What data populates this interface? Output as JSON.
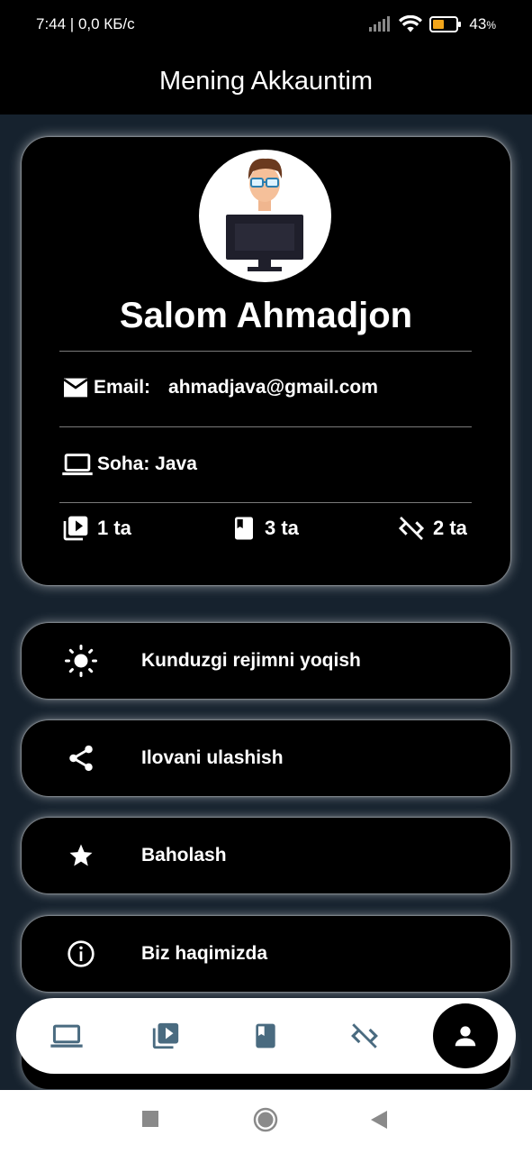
{
  "status_bar": {
    "time_speed": "7:44 | 0,0 КБ/с",
    "battery_percent": "43",
    "battery_unit": "%"
  },
  "app_bar": {
    "title": "Mening Akkauntim"
  },
  "profile": {
    "greeting": "Salom Ahmadjon",
    "email_label": "Email:",
    "email_value": "ahmadjava@gmail.com",
    "field_label": "Soha: Java",
    "stats": [
      {
        "icon": "video-library-icon",
        "value": "1 ta"
      },
      {
        "icon": "book-icon",
        "value": "3 ta"
      },
      {
        "icon": "code-off-icon",
        "value": "2 ta"
      }
    ]
  },
  "menu": [
    {
      "icon": "sun-icon",
      "label": "Kunduzgi rejimni yoqish"
    },
    {
      "icon": "share-icon",
      "label": "Ilovani ulashish"
    },
    {
      "icon": "star-icon",
      "label": "Baholash"
    },
    {
      "icon": "info-icon",
      "label": "Biz haqimizda"
    }
  ],
  "bottom_nav": {
    "items": [
      "laptop-icon",
      "video-library-icon",
      "book-icon",
      "code-off-icon",
      "person-icon"
    ],
    "active": "person-icon",
    "icon_color": "#4a6b80"
  },
  "colors": {
    "background": "#16222e",
    "card": "#000000",
    "nav_bg": "#ffffff",
    "battery_fill": "#f2a51a"
  }
}
